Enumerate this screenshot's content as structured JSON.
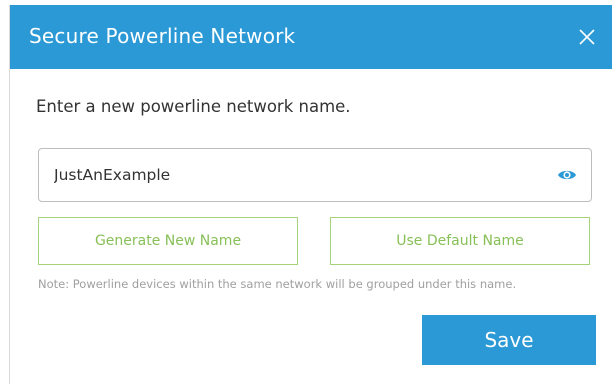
{
  "dialog": {
    "title": "Secure Powerline Network",
    "close_icon": "close-icon",
    "prompt": "Enter a new powerline network name.",
    "name_field": {
      "value": "JustAnExample",
      "eye_icon": "eye-icon"
    },
    "generate_button_label": "Generate New Name",
    "default_button_label": "Use Default Name",
    "note": "Note: Powerline devices within the same network will be grouped under this name.",
    "save_button_label": "Save"
  },
  "colors": {
    "accent": "#2b99d6",
    "button_outline": "#a6d27a",
    "button_text": "#88c058"
  }
}
